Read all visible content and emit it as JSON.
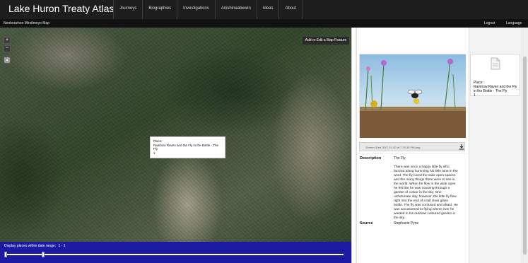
{
  "app": {
    "title": "Lake Huron Treaty Atlas"
  },
  "nav": {
    "items": [
      {
        "label": "Journeys"
      },
      {
        "label": "Biographies"
      },
      {
        "label": "Investigations"
      },
      {
        "label": "Anishinaabewin"
      },
      {
        "label": "Ideas"
      },
      {
        "label": "About"
      }
    ]
  },
  "subbar": {
    "map_title": "Nenboozhoo Mindimoye Map",
    "logout": "Logout",
    "language": "Language"
  },
  "map": {
    "zoom_in": "+",
    "zoom_out": "−",
    "layer_icon": "layers-icon",
    "add_feature": "Add or Edit a Map Feature",
    "popup_label": "Place:",
    "popup_title": "Rainbow Raven and the Fly in the Bottle - The Fly",
    "popup_number": "1"
  },
  "date_range": {
    "label": "Display places within date range:",
    "value": "1 - 1",
    "start_fraction": 0.0,
    "end_fraction": 0.11
  },
  "detail": {
    "image_caption": "Screen Shot 2017-10-02 at 7.20.36 PM.png",
    "download_icon": "download-icon",
    "description_label": "Description",
    "description_title": "The Fly",
    "description_lines": [
      "There was once a happy little fly who",
      "buzzed along humming his little tune in the",
      "wind. The fly loved the wide open spaces",
      "and the many things there were to see in",
      "the world. When he flew in the wide open",
      "he felt like he was zooming through a",
      "garden of colour in the sky. One",
      "unfortunate day, however, the little fly flew",
      "right into the end of a tall clear glass",
      "bottle. The fly was confused and afraid. He",
      "was accustomed to flying where ever he",
      "wanted in his rainbow coloured garden in",
      "the sky."
    ],
    "source_label": "Source",
    "source_value": "Stephanie Pyne"
  },
  "place_panel": {
    "icon": "document-icon",
    "label": "Place:",
    "name_line1": "Rainbow Raven and the Fly",
    "name_line2": "in the Bottle - The Fly",
    "number": "1"
  },
  "colors": {
    "nav_bg": "#1d1d1d",
    "range_bar": "#1b1aa0"
  }
}
